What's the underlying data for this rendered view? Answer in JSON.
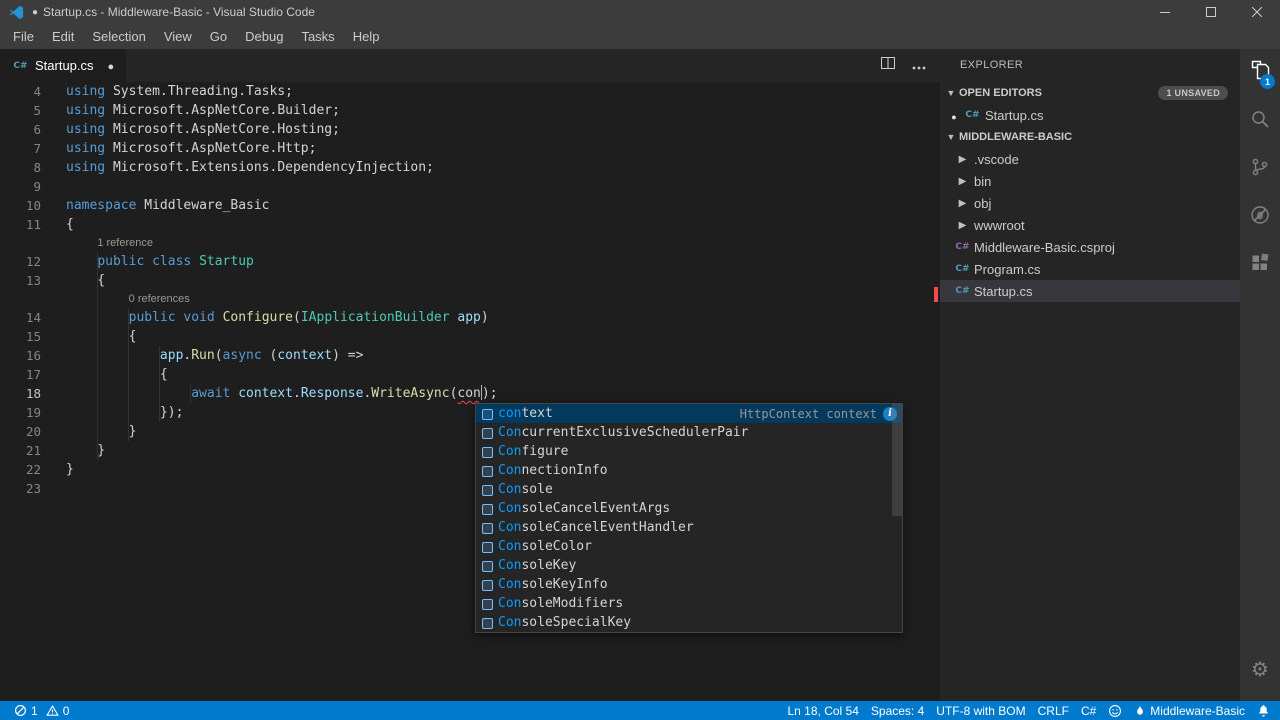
{
  "title_bar": {
    "modified_indicator": "●",
    "title": "Startup.cs - Middleware-Basic - Visual Studio Code"
  },
  "menu_bar": {
    "items": [
      "File",
      "Edit",
      "Selection",
      "View",
      "Go",
      "Debug",
      "Tasks",
      "Help"
    ]
  },
  "editor_tab_bar": {
    "active_tab": {
      "label": "Startup.cs",
      "modified": true
    }
  },
  "editor": {
    "cursor": {
      "line": 18,
      "col": 54,
      "status": "Ln 18, Col 54"
    },
    "lines": [
      {
        "n": "4",
        "seg": [
          [
            "using",
            "kw"
          ],
          [
            " System.Threading.Tasks;",
            "pl"
          ]
        ]
      },
      {
        "n": "5",
        "seg": [
          [
            "using",
            "kw"
          ],
          [
            " Microsoft.AspNetCore.Builder;",
            "pl"
          ]
        ]
      },
      {
        "n": "6",
        "seg": [
          [
            "using",
            "kw"
          ],
          [
            " Microsoft.AspNetCore.Hosting;",
            "pl"
          ]
        ]
      },
      {
        "n": "7",
        "seg": [
          [
            "using",
            "kw"
          ],
          [
            " Microsoft.AspNetCore.Http;",
            "pl"
          ]
        ]
      },
      {
        "n": "8",
        "seg": [
          [
            "using",
            "kw"
          ],
          [
            " Microsoft.Extensions.DependencyInjection;",
            "pl"
          ]
        ]
      },
      {
        "n": "9",
        "seg": []
      },
      {
        "n": "10",
        "seg": [
          [
            "namespace",
            "kw"
          ],
          [
            " Middleware_Basic",
            "pl"
          ]
        ]
      },
      {
        "n": "11",
        "seg": [
          [
            "{",
            "pl"
          ]
        ]
      },
      {
        "codelens": "1 reference",
        "indent": 4
      },
      {
        "n": "12",
        "seg": [
          [
            "    ",
            "pl"
          ],
          [
            "public",
            "kw"
          ],
          [
            " ",
            "pl"
          ],
          [
            "class",
            "kw"
          ],
          [
            " ",
            "pl"
          ],
          [
            "Startup",
            "type"
          ]
        ]
      },
      {
        "n": "13",
        "seg": [
          [
            "    {",
            "pl"
          ]
        ]
      },
      {
        "codelens": "0 references",
        "indent": 8
      },
      {
        "n": "14",
        "seg": [
          [
            "        ",
            "pl"
          ],
          [
            "public",
            "kw"
          ],
          [
            " ",
            "pl"
          ],
          [
            "void",
            "kw"
          ],
          [
            " ",
            "pl"
          ],
          [
            "Configure",
            "method"
          ],
          [
            "(",
            "pl"
          ],
          [
            "IApplicationBuilder",
            "type"
          ],
          [
            " ",
            "pl"
          ],
          [
            "app",
            "var"
          ],
          [
            ")",
            "pl"
          ]
        ]
      },
      {
        "n": "15",
        "seg": [
          [
            "        {",
            "pl"
          ]
        ]
      },
      {
        "n": "16",
        "seg": [
          [
            "            ",
            "pl"
          ],
          [
            "app",
            "var"
          ],
          [
            ".",
            "pl"
          ],
          [
            "Run",
            "method"
          ],
          [
            "(",
            "pl"
          ],
          [
            "async",
            "kw"
          ],
          [
            " (",
            "pl"
          ],
          [
            "context",
            "var"
          ],
          [
            ") =>",
            "pl"
          ]
        ]
      },
      {
        "n": "17",
        "seg": [
          [
            "            {",
            "pl"
          ]
        ]
      },
      {
        "n": "18",
        "seg": [
          [
            "                ",
            "pl"
          ],
          [
            "await",
            "kw"
          ],
          [
            " ",
            "pl"
          ],
          [
            "context",
            "var"
          ],
          [
            ".",
            "pl"
          ],
          [
            "Response",
            "var"
          ],
          [
            ".",
            "pl"
          ],
          [
            "WriteAsync",
            "method"
          ],
          [
            "(",
            "pl"
          ],
          [
            "con",
            "err"
          ],
          [
            "",
            "caret"
          ],
          [
            ")",
            "pl"
          ],
          [
            ";",
            "pl"
          ]
        ]
      },
      {
        "n": "19",
        "seg": [
          [
            "            });",
            "pl"
          ]
        ]
      },
      {
        "n": "20",
        "seg": [
          [
            "        }",
            "pl"
          ]
        ]
      },
      {
        "n": "21",
        "seg": [
          [
            "    }",
            "pl"
          ]
        ]
      },
      {
        "n": "22",
        "seg": [
          [
            "}",
            "pl"
          ]
        ]
      },
      {
        "n": "23",
        "seg": []
      }
    ]
  },
  "suggest_widget": {
    "items": [
      {
        "match": "con",
        "rest": "text",
        "kind": "variable",
        "detail": "HttpContext context",
        "selected": true
      },
      {
        "match": "Con",
        "rest": "currentExclusiveSchedulerPair",
        "kind": "class"
      },
      {
        "match": "Con",
        "rest": "figure",
        "kind": "method"
      },
      {
        "match": "Con",
        "rest": "nectionInfo",
        "kind": "class"
      },
      {
        "match": "Con",
        "rest": "sole",
        "kind": "class"
      },
      {
        "match": "Con",
        "rest": "soleCancelEventArgs",
        "kind": "class"
      },
      {
        "match": "Con",
        "rest": "soleCancelEventHandler",
        "kind": "delegate"
      },
      {
        "match": "Con",
        "rest": "soleColor",
        "kind": "enum"
      },
      {
        "match": "Con",
        "rest": "soleKey",
        "kind": "enum"
      },
      {
        "match": "Con",
        "rest": "soleKeyInfo",
        "kind": "struct"
      },
      {
        "match": "Con",
        "rest": "soleModifiers",
        "kind": "enum"
      },
      {
        "match": "Con",
        "rest": "soleSpecialKey",
        "kind": "enum"
      }
    ]
  },
  "sidebar": {
    "title": "EXPLORER",
    "open_editors": {
      "label": "OPEN EDITORS",
      "badge": "1 UNSAVED",
      "items": [
        {
          "label": "Startup.cs",
          "modified": true,
          "icon": "cs"
        }
      ]
    },
    "project": {
      "label": "MIDDLEWARE-BASIC",
      "items": [
        {
          "label": ".vscode",
          "type": "folder"
        },
        {
          "label": "bin",
          "type": "folder"
        },
        {
          "label": "obj",
          "type": "folder"
        },
        {
          "label": "wwwroot",
          "type": "folder"
        },
        {
          "label": "Middleware-Basic.csproj",
          "type": "csproj"
        },
        {
          "label": "Program.cs",
          "type": "cs"
        },
        {
          "label": "Startup.cs",
          "type": "cs",
          "selected": true
        }
      ]
    }
  },
  "activity_bar": {
    "items": [
      {
        "name": "explorer",
        "active": true,
        "badge": "1"
      },
      {
        "name": "search"
      },
      {
        "name": "source-control"
      },
      {
        "name": "debug"
      },
      {
        "name": "extensions"
      }
    ],
    "bottom": [
      {
        "name": "settings"
      }
    ]
  },
  "status_bar": {
    "errors": "1",
    "warnings": "0",
    "right_items": [
      {
        "name": "cursor-position",
        "label": "Ln 18, Col 54"
      },
      {
        "name": "indentation",
        "label": "Spaces: 4"
      },
      {
        "name": "encoding",
        "label": "UTF-8 with BOM"
      },
      {
        "name": "eol",
        "label": "CRLF"
      },
      {
        "name": "language-mode",
        "label": "C#"
      },
      {
        "name": "feedback",
        "icon": "smiley",
        "label": ""
      },
      {
        "name": "project-selector",
        "icon": "flame",
        "label": "Middleware-Basic"
      },
      {
        "name": "notifications",
        "icon": "bell",
        "label": ""
      }
    ]
  },
  "colors": {
    "accent": "#007acc",
    "error": "#f14c4c",
    "match_highlight": "#0a9cfb"
  }
}
